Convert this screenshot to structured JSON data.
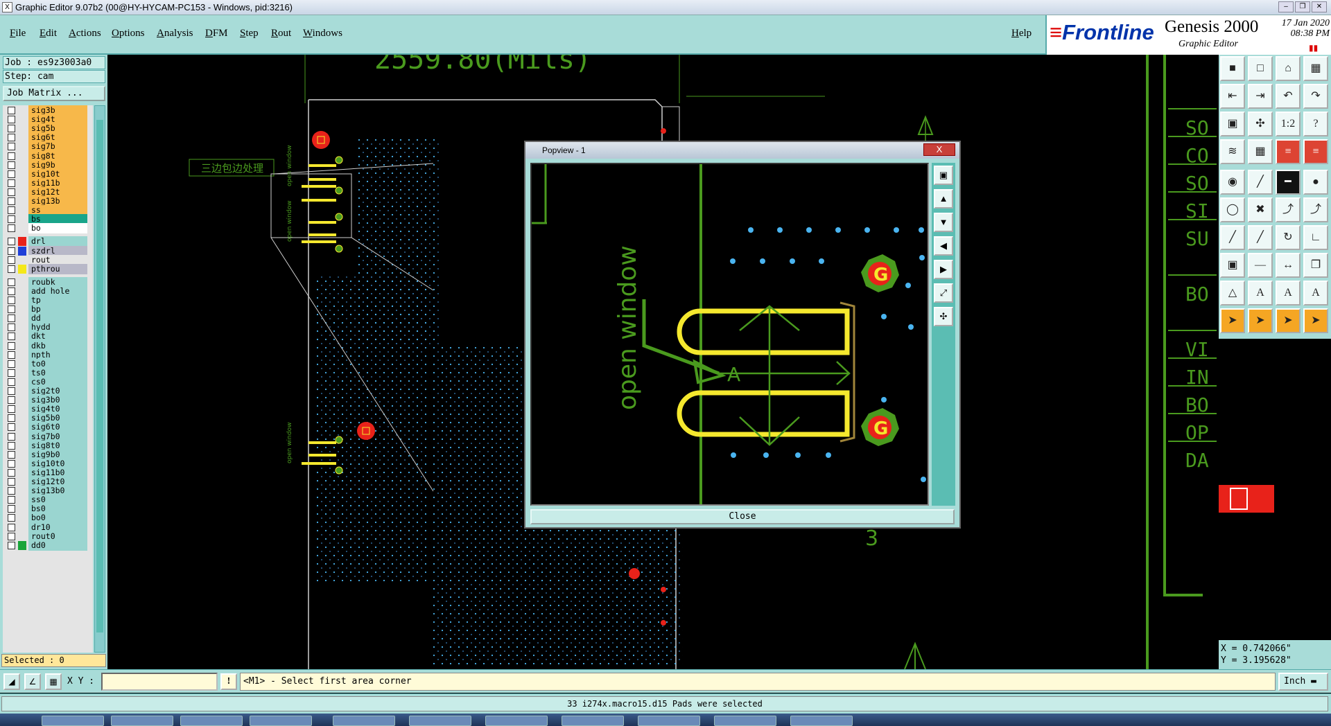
{
  "window": {
    "title": "Graphic Editor 9.07b2 (00@HY-HYCAM-PC153 - Windows, pid:3216)",
    "icon_label": "X"
  },
  "menubar": {
    "items": [
      "File",
      "Edit",
      "Actions",
      "Options",
      "Analysis",
      "DFM",
      "Step",
      "Rout",
      "Windows"
    ],
    "help": "Help"
  },
  "brand": {
    "logo": "Frontline",
    "product": "Genesis 2000",
    "subtitle": "Graphic Editor",
    "date": "17 Jan 2020",
    "time": "08:38 PM"
  },
  "job": {
    "job_line": "Job : es9z3003a0",
    "step_line": "Step: cam",
    "matrix_button": "Job Matrix ..."
  },
  "layers": [
    {
      "name": "sig3b",
      "color": "#f7b84a",
      "swatch": ""
    },
    {
      "name": "sig4t",
      "color": "#f7b84a",
      "swatch": ""
    },
    {
      "name": "sig5b",
      "color": "#f7b84a",
      "swatch": ""
    },
    {
      "name": "sig6t",
      "color": "#f7b84a",
      "swatch": ""
    },
    {
      "name": "sig7b",
      "color": "#f7b84a",
      "swatch": ""
    },
    {
      "name": "sig8t",
      "color": "#f7b84a",
      "swatch": ""
    },
    {
      "name": "sig9b",
      "color": "#f7b84a",
      "swatch": ""
    },
    {
      "name": "sig10t",
      "color": "#f7b84a",
      "swatch": ""
    },
    {
      "name": "sig11b",
      "color": "#f7b84a",
      "swatch": ""
    },
    {
      "name": "sig12t",
      "color": "#f7b84a",
      "swatch": ""
    },
    {
      "name": "sig13b",
      "color": "#f7b84a",
      "swatch": ""
    },
    {
      "name": "ss",
      "color": "#f7b84a",
      "swatch": ""
    },
    {
      "name": "bs",
      "color": "#1aa58a",
      "swatch": ""
    },
    {
      "name": "bo",
      "color": "#ffffff",
      "swatch": ""
    },
    {
      "name": "drl",
      "color": "#9ad5d0",
      "swatch": "#e8221a"
    },
    {
      "name": "szdrl",
      "color": "#b8b8c8",
      "swatch": "#1f3fd8"
    },
    {
      "name": "rout",
      "color": "#e4e4e4",
      "swatch": ""
    },
    {
      "name": "pthrou",
      "color": "#b8b8c8",
      "swatch": "#f5e81a"
    },
    {
      "name": "roubk",
      "color": "#9ad5d0",
      "swatch": ""
    },
    {
      "name": "add_hole",
      "color": "#9ad5d0",
      "swatch": ""
    },
    {
      "name": "tp",
      "color": "#9ad5d0",
      "swatch": ""
    },
    {
      "name": "bp",
      "color": "#9ad5d0",
      "swatch": ""
    },
    {
      "name": "dd",
      "color": "#9ad5d0",
      "swatch": ""
    },
    {
      "name": "hydd",
      "color": "#9ad5d0",
      "swatch": ""
    },
    {
      "name": "dkt",
      "color": "#9ad5d0",
      "swatch": ""
    },
    {
      "name": "dkb",
      "color": "#9ad5d0",
      "swatch": ""
    },
    {
      "name": "npth",
      "color": "#9ad5d0",
      "swatch": ""
    },
    {
      "name": "to0",
      "color": "#9ad5d0",
      "swatch": ""
    },
    {
      "name": "ts0",
      "color": "#9ad5d0",
      "swatch": ""
    },
    {
      "name": "cs0",
      "color": "#9ad5d0",
      "swatch": ""
    },
    {
      "name": "sig2t0",
      "color": "#9ad5d0",
      "swatch": ""
    },
    {
      "name": "sig3b0",
      "color": "#9ad5d0",
      "swatch": ""
    },
    {
      "name": "sig4t0",
      "color": "#9ad5d0",
      "swatch": ""
    },
    {
      "name": "sig5b0",
      "color": "#9ad5d0",
      "swatch": ""
    },
    {
      "name": "sig6t0",
      "color": "#9ad5d0",
      "swatch": ""
    },
    {
      "name": "sig7b0",
      "color": "#9ad5d0",
      "swatch": ""
    },
    {
      "name": "sig8t0",
      "color": "#9ad5d0",
      "swatch": ""
    },
    {
      "name": "sig9b0",
      "color": "#9ad5d0",
      "swatch": ""
    },
    {
      "name": "sig10t0",
      "color": "#9ad5d0",
      "swatch": ""
    },
    {
      "name": "sig11b0",
      "color": "#9ad5d0",
      "swatch": ""
    },
    {
      "name": "sig12t0",
      "color": "#9ad5d0",
      "swatch": ""
    },
    {
      "name": "sig13b0",
      "color": "#9ad5d0",
      "swatch": ""
    },
    {
      "name": "ss0",
      "color": "#9ad5d0",
      "swatch": ""
    },
    {
      "name": "bs0",
      "color": "#9ad5d0",
      "swatch": ""
    },
    {
      "name": "bo0",
      "color": "#9ad5d0",
      "swatch": ""
    },
    {
      "name": "dr10",
      "color": "#9ad5d0",
      "swatch": ""
    },
    {
      "name": "rout0",
      "color": "#9ad5d0",
      "swatch": ""
    },
    {
      "name": "dd0",
      "color": "#9ad5d0",
      "swatch": "#1aa53a"
    }
  ],
  "selected_count": "Selected : 0",
  "canvas": {
    "dimension_text": "2559.80(Mils)",
    "note_text": "三边包边处理",
    "slot_label": "open window",
    "right_labels": [
      "SO",
      "CO",
      "SO",
      "SI",
      "SU",
      "BO",
      "VI",
      "IN",
      "BO",
      "OP",
      "DA"
    ],
    "digit_label": "3"
  },
  "popview": {
    "title": "Popview - 1",
    "close_button": "Close",
    "label_text": "open window",
    "arrow_label": "A",
    "pad_label": "G",
    "x_button": "X"
  },
  "coords": {
    "x": "X = 0.742066\"",
    "y": "Y = 3.195628\""
  },
  "command": {
    "xy_label": "X Y :",
    "xy_value": "",
    "prompt": "<M1> - Select first area corner",
    "unit": "Inch"
  },
  "status_message": "33 i274x.macro15.d15 Pads were selected",
  "colors": {
    "ui_teal": "#a8dcd8",
    "board_green": "#4a9a1e",
    "highlight_yellow": "#f5e82e",
    "via_blue": "#4ab4f0",
    "pad_red": "#e8221a"
  }
}
